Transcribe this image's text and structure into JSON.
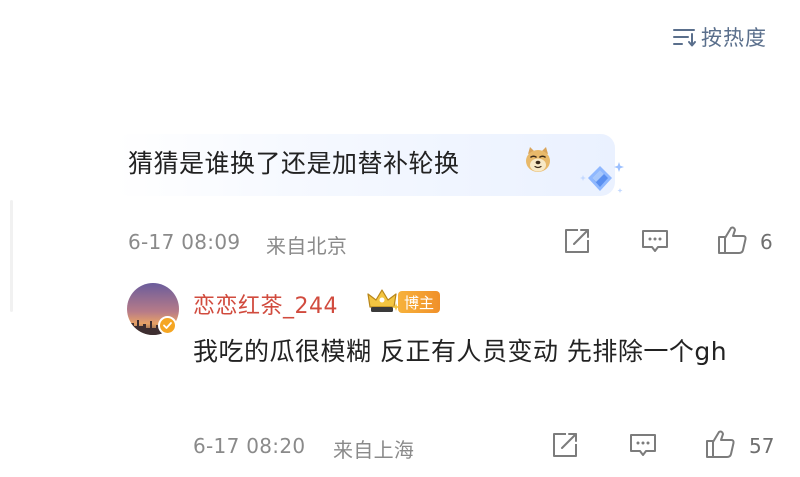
{
  "sort": {
    "label": "按热度",
    "icon": "sort-lines-icon"
  },
  "comment": {
    "text": "猜猜是谁换了还是加替补轮换",
    "emoji": "doge-emoji-icon",
    "decoration": "diamond-sparkle-icon",
    "time": "6-17 08:09",
    "location": "来自北京",
    "like_count": "6"
  },
  "reply": {
    "username": "恋恋红茶_244",
    "badge_label": "博主",
    "text": "我吃的瓜很模糊 反正有人员变动 先排除一个gh",
    "time": "6-17 08:20",
    "location": "来自上海",
    "like_count": "57"
  },
  "colors": {
    "username": "#d14b3e",
    "meta_text": "#8a8a8a",
    "sort_text": "#5a6f8c",
    "host_badge": "#f0902a",
    "icon_gray": "#7c7c7c"
  }
}
